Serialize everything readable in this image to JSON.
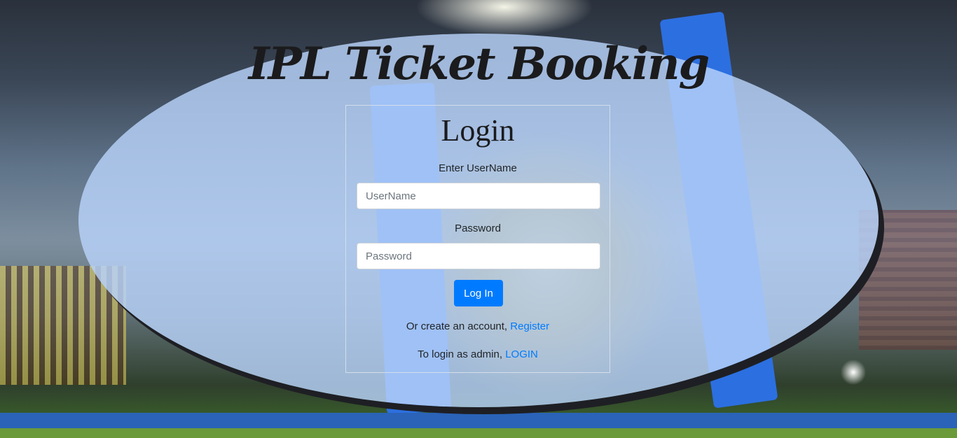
{
  "page": {
    "title": "IPL Ticket Booking"
  },
  "login": {
    "heading": "Login",
    "username_label": "Enter UserName",
    "username_placeholder": "UserName",
    "password_label": "Password",
    "password_placeholder": "Password",
    "submit_label": "Log In",
    "register_prompt": "Or create an account,",
    "register_link": "Register",
    "admin_prompt": "To login as admin,",
    "admin_link": "LOGIN"
  },
  "colors": {
    "accent": "#007bff",
    "panel": "#b8d3fa",
    "panel_shadow": "#1e1f24"
  }
}
